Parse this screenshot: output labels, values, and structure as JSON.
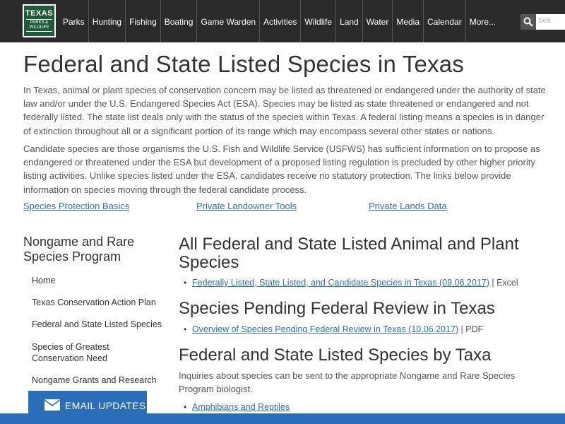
{
  "logo": {
    "line1": "TEXAS",
    "line2": "PARKS & WILDLIFE"
  },
  "nav": [
    "Parks",
    "Hunting",
    "Fishing",
    "Boating",
    "Game Warden",
    "Activities",
    "Wildlife",
    "Land",
    "Water",
    "Media",
    "Calendar",
    "More..."
  ],
  "search": {
    "placeholder": "Sea"
  },
  "page_title": "Federal and State Listed Species in Texas",
  "intro": [
    "In Texas, animal or plant species of conservation concern may be listed as threatened or endangered under the authority of state law and/or under the U.S. Endangered Species Act (ESA). Species may be listed as state threatened or endangered and not federally listed. The state list deals only with the status of the species within Texas. A federal listing means a species is in danger of extinction throughout all or a significant portion of its range which may encompass several other states or nations.",
    "Candidate species are those organisms the U.S. Fish and Wildlife Service (USFWS) has sufficient information on to propose as endangered or threatened under the ESA but development of a proposed listing regulation is precluded by other higher priority listing activities. Unlike species listed under the ESA, candidates receive no statutory protection. The links below provide information on species moving through the federal candidate process."
  ],
  "quick_links": [
    "Species Protection Basics",
    "Private Landowner Tools",
    "Private Lands Data"
  ],
  "sidebar": {
    "title": "Nongame and Rare Species Program",
    "items": [
      "Home",
      "Texas Conservation Action Plan",
      "Federal and State Listed Species",
      "Species of Greatest Conservation Need",
      "Nongame Grants and Research"
    ]
  },
  "sections": [
    {
      "heading": "All Federal and State Listed Animal and Plant Species",
      "link": "Federally Listed, State Listed, and Candidate Species in Texas (09.06.2017)",
      "suffix": " | Excel"
    },
    {
      "heading": "Species Pending Federal Review in Texas",
      "link": "Overview of Species Pending Federal Review in Texas (10.06.2017)",
      "suffix": " | PDF"
    },
    {
      "heading": "Federal and State Listed Species by Taxa",
      "text": "Inquiries about species can be sent to the appropriate Nongame and Rare Species Program biologist.",
      "link": "Amphibians and Reptiles"
    }
  ],
  "email_updates": "EMAIL UPDATES",
  "colors": {
    "nav_bg": "#2b2b2b",
    "link": "#2e6fb5",
    "logo_green": "#1e5b3a",
    "email_blue": "#2a6db8"
  }
}
